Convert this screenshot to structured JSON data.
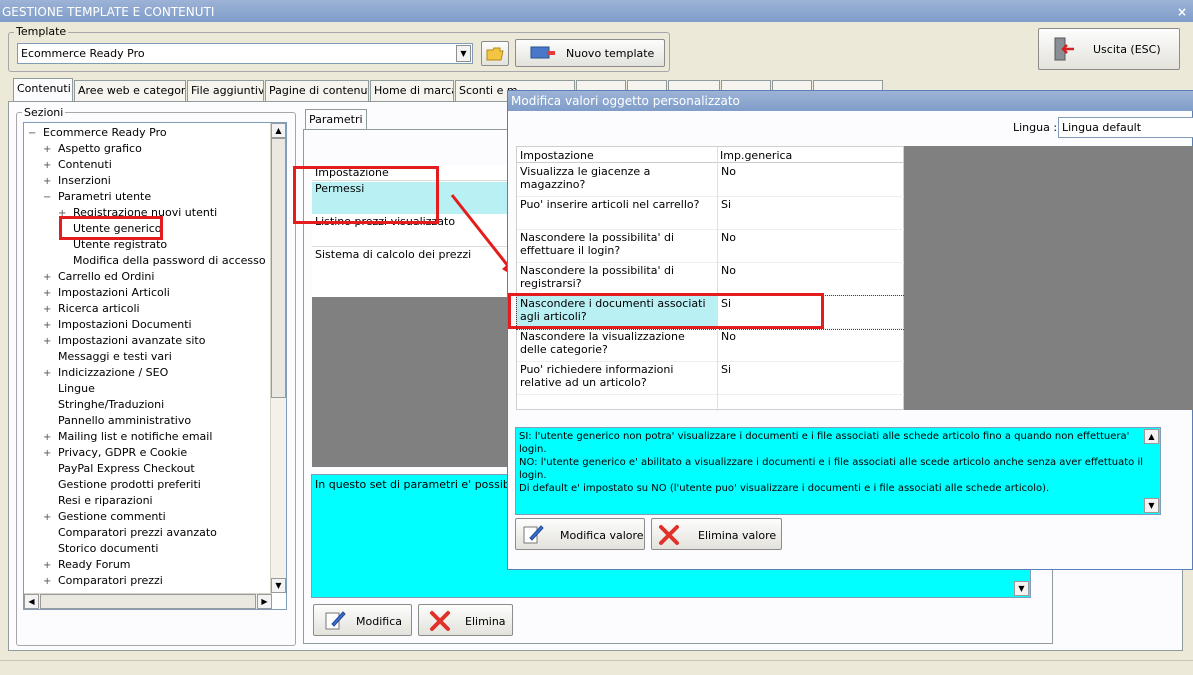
{
  "window": {
    "title": "GESTIONE TEMPLATE E CONTENUTI",
    "close": "×"
  },
  "template": {
    "legend": "Template",
    "selected": "Ecommerce Ready Pro",
    "new_button": "Nuovo template",
    "exit_button": "Uscita (ESC)"
  },
  "tabs": [
    "Contenuti",
    "Aree web e categorie",
    "File aggiuntivi",
    "Pagine di contenuti",
    "Home di marca",
    "Sconti e m",
    "",
    "",
    "",
    "",
    "",
    ""
  ],
  "sections": {
    "legend": "Sezioni",
    "items": [
      {
        "label": "Ecommerce Ready Pro",
        "prefix": "−",
        "indent": 0
      },
      {
        "label": "Aspetto grafico",
        "prefix": "+",
        "indent": 1
      },
      {
        "label": "Contenuti",
        "prefix": "+",
        "indent": 1
      },
      {
        "label": "Inserzioni",
        "prefix": "+",
        "indent": 1
      },
      {
        "label": "Parametri utente",
        "prefix": "−",
        "indent": 1
      },
      {
        "label": "Registrazione nuovi utenti",
        "prefix": "+",
        "indent": 2
      },
      {
        "label": "Utente generico",
        "prefix": "",
        "indent": 2
      },
      {
        "label": "Utente registrato",
        "prefix": "",
        "indent": 2
      },
      {
        "label": "Modifica della password di accesso",
        "prefix": "",
        "indent": 2
      },
      {
        "label": "Carrello ed Ordini",
        "prefix": "+",
        "indent": 1
      },
      {
        "label": "Impostazioni Articoli",
        "prefix": "+",
        "indent": 1
      },
      {
        "label": "Ricerca articoli",
        "prefix": "+",
        "indent": 1
      },
      {
        "label": "Impostazioni Documenti",
        "prefix": "+",
        "indent": 1
      },
      {
        "label": "Impostazioni avanzate sito",
        "prefix": "+",
        "indent": 1
      },
      {
        "label": "Messaggi e testi vari",
        "prefix": "",
        "indent": 1
      },
      {
        "label": "Indicizzazione / SEO",
        "prefix": "+",
        "indent": 1
      },
      {
        "label": "Lingue",
        "prefix": "",
        "indent": 1
      },
      {
        "label": "Stringhe/Traduzioni",
        "prefix": "",
        "indent": 1
      },
      {
        "label": "Pannello amministrativo",
        "prefix": "",
        "indent": 1
      },
      {
        "label": "Mailing list e notifiche email",
        "prefix": "+",
        "indent": 1
      },
      {
        "label": "Privacy, GDPR e Cookie",
        "prefix": "+",
        "indent": 1
      },
      {
        "label": "PayPal Express Checkout",
        "prefix": "",
        "indent": 1
      },
      {
        "label": "Gestione prodotti preferiti",
        "prefix": "",
        "indent": 1
      },
      {
        "label": "Resi e riparazioni",
        "prefix": "",
        "indent": 1
      },
      {
        "label": "Gestione commenti",
        "prefix": "+",
        "indent": 1
      },
      {
        "label": "Comparatori prezzi avanzato",
        "prefix": "",
        "indent": 1
      },
      {
        "label": "Storico documenti",
        "prefix": "",
        "indent": 1
      },
      {
        "label": "Ready Forum",
        "prefix": "+",
        "indent": 1
      },
      {
        "label": "Comparatori prezzi",
        "prefix": "+",
        "indent": 1
      }
    ]
  },
  "params": {
    "tab": "Parametri",
    "header": "Impostazione",
    "rows": [
      "Permessi",
      "Listino prezzi visualizzato",
      "Sistema di calcolo dei prezzi"
    ],
    "description": "In questo set di parametri e' possibile sp",
    "edit_button": "Modifica",
    "delete_button": "Elimina"
  },
  "dialog": {
    "title": "Modifica valori oggetto personalizzato",
    "lang_label": "Lingua :",
    "lang_value": "Lingua default",
    "col1": "Impostazione",
    "col2": "Imp.generica",
    "rows": [
      {
        "setting": "Visualizza le giacenze a magazzino?",
        "value": "No"
      },
      {
        "setting": "Puo' inserire articoli nel carrello?",
        "value": "Si"
      },
      {
        "setting": "Nascondere la possibilita' di effettuare il login?",
        "value": "No"
      },
      {
        "setting": "Nascondere la possibilita' di registrarsi?",
        "value": "No"
      },
      {
        "setting": "Nascondere i documenti associati agli articoli?",
        "value": "Si"
      },
      {
        "setting": "Nascondere la visualizzazione delle categorie?",
        "value": "No"
      },
      {
        "setting": "Puo' richiedere informazioni relative ad un articolo?",
        "value": "Si"
      }
    ],
    "desc1": "SI: l'utente generico non potra' visualizzare i documenti e i file associati alle schede articolo fino a quando non effettuera' login.",
    "desc2": "NO: l'utente generico e' abilitato a visualizzare i documenti e i file associati alle scede articolo anche senza aver effettuato il login.",
    "desc3": "Di default e' impostato su NO (l'utente puo' visualizzare i documenti e i file associati alle schede articolo).",
    "edit_value_button": "Modifica valore",
    "delete_value_button": "Elimina valore"
  },
  "colors": {
    "highlight": "#e31d1d",
    "cyan": "#00ffff",
    "selected_row": "#b8f0f4"
  }
}
